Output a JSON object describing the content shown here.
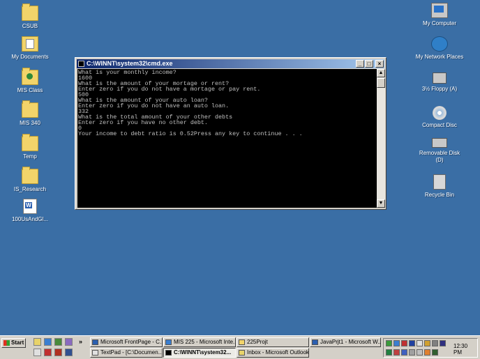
{
  "desktop": {
    "left_icons": [
      {
        "label": "CSUB",
        "icon": "folder-icon"
      },
      {
        "label": "My Documents",
        "icon": "my-documents-icon"
      },
      {
        "label": "MIS Class",
        "icon": "folder-icon"
      },
      {
        "label": "MIS 340",
        "icon": "folder-icon"
      },
      {
        "label": "Temp",
        "icon": "folder-icon"
      },
      {
        "label": "IS_Research",
        "icon": "folder-icon"
      },
      {
        "label": "100UsAndGl...",
        "icon": "word-document-icon"
      }
    ],
    "right_icons": [
      {
        "label": "My Computer",
        "icon": "computer-icon"
      },
      {
        "label": "My Network Places",
        "icon": "network-icon"
      },
      {
        "label": "3½ Floppy (A)",
        "icon": "floppy-icon"
      },
      {
        "label": "Compact Disc",
        "icon": "cd-icon"
      },
      {
        "label": "Removable Disk (D)",
        "icon": "removable-disk-icon"
      },
      {
        "label": "Recycle Bin",
        "icon": "recycle-bin-icon"
      }
    ]
  },
  "window": {
    "title": "C:\\WINNT\\system32\\cmd.exe",
    "minimize": "_",
    "maximize": "□",
    "close": "×",
    "console_lines": [
      "What is your monthly income?",
      "1600",
      "What is the amount of your mortage or rent?",
      "Enter zero if you do not have a mortage or pay rent.",
      "500",
      "What is the amount of your auto loan?",
      "Enter zero if you do not have an auto loan.",
      "332",
      "What is the total amount of your other debts",
      "Enter zero if you have no other debt.",
      "0",
      "Your income to debt ratio is 0.52Press any key to continue . . ."
    ]
  },
  "taskbar": {
    "start_label": "Start",
    "tasks_row1": [
      {
        "label": "Microsoft FrontPage - C...",
        "icon": "frontpage-icon"
      },
      {
        "label": "MIS 225 - Microsoft Inte...",
        "icon": "ie-icon"
      },
      {
        "label": "225Projt",
        "icon": "folder-icon"
      },
      {
        "label": "JavaPrjt1 - Microsoft W...",
        "icon": "word-icon"
      }
    ],
    "tasks_row2": [
      {
        "label": "TextPad - [C:\\Documen...",
        "icon": "textpad-icon"
      },
      {
        "label": "C:\\WINNT\\system32...",
        "icon": "cmd-icon",
        "active": true
      },
      {
        "label": "Inbox - Microsoft Outlook",
        "icon": "outlook-icon"
      }
    ],
    "clock": "12:30 PM",
    "quicklaunch_more": "»"
  }
}
